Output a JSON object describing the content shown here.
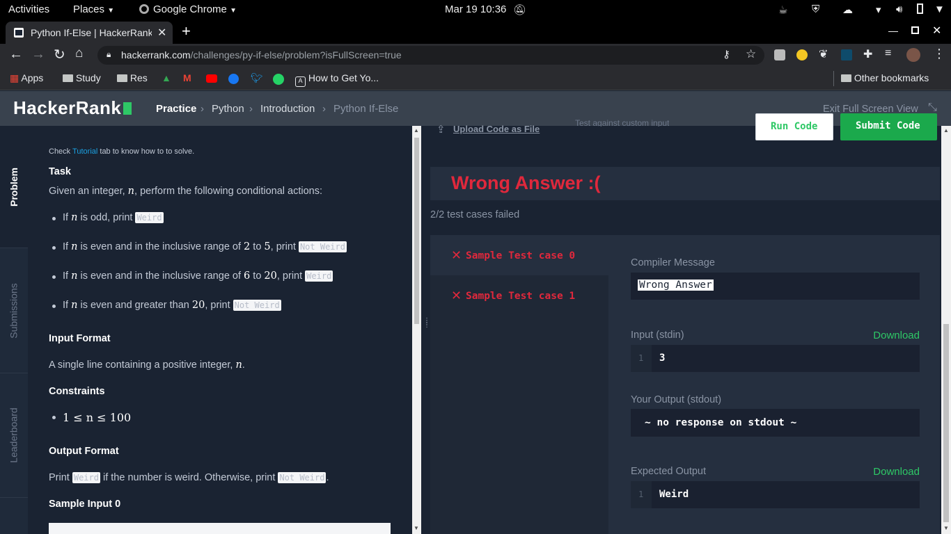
{
  "system": {
    "activities": "Activities",
    "places": "Places",
    "app": "Google Chrome",
    "clock": "Mar 19  10:36"
  },
  "browser": {
    "tab_title": "Python If-Else | HackerRank",
    "url_domain": "hackerrank.com",
    "url_path": "/challenges/py-if-else/problem?isFullScreen=true",
    "bookmarks": [
      "Apps",
      "Study",
      "Res",
      "How to Get Yo..."
    ],
    "other_bookmarks": "Other bookmarks"
  },
  "header": {
    "logo": "HackerRank",
    "breadcrumb": [
      "Practice",
      "Python",
      "Introduction",
      "Python If-Else"
    ],
    "exit_fullscreen": "Exit Full Screen View"
  },
  "side_tabs": [
    "Problem",
    "Submissions",
    "Leaderboard"
  ],
  "problem": {
    "hint_pre": "Check ",
    "hint_link": "Tutorial",
    "hint_post": " tab to know how to to solve.",
    "task_heading": "Task",
    "task_text_pre": "Given an integer, ",
    "task_var": "n",
    "task_text_post": ", perform the following conditional actions:",
    "bullets": [
      {
        "pre": "If ",
        "var": "n",
        "mid": " is odd, print ",
        "out": "Weird"
      },
      {
        "pre": "If ",
        "var": "n",
        "mid": " is even and in the inclusive range of ",
        "a": "2",
        "to": " to ",
        "b": "5",
        "mid2": ", print ",
        "out": "Not Weird"
      },
      {
        "pre": "If ",
        "var": "n",
        "mid": " is even and in the inclusive range of ",
        "a": "6",
        "to": " to ",
        "b": "20",
        "mid2": ", print ",
        "out": "Weird"
      },
      {
        "pre": "If ",
        "var": "n",
        "mid": " is even and greater than ",
        "a": "20",
        "mid2": ", print ",
        "out": "Not Weird"
      }
    ],
    "input_heading": "Input Format",
    "input_text": "A single line containing a positive integer, ",
    "input_var": "n",
    "input_end": ".",
    "constraints_heading": "Constraints",
    "constraint": "1 ≤ n ≤ 100",
    "output_heading": "Output Format",
    "output_pre": "Print ",
    "output_code1": "Weird",
    "output_mid": " if the number is weird. Otherwise, print ",
    "output_code2": "Not Weird",
    "output_end": ".",
    "sample_heading": "Sample Input 0"
  },
  "editor": {
    "upload": "Upload Code as File",
    "custom_input": "Test against custom input",
    "run": "Run Code",
    "submit": "Submit Code"
  },
  "result": {
    "title": "Wrong Answer :(",
    "summary": "2/2 test cases failed",
    "cases": [
      "Sample Test case 0",
      "Sample Test case 1"
    ],
    "compiler_label": "Compiler Message",
    "compiler_message": "Wrong Answer",
    "input_label": "Input (stdin)",
    "download": "Download",
    "input_line_no": "1",
    "input_value": "3",
    "output_label": "Your Output (stdout)",
    "output_value": "~ no response on stdout ~",
    "expected_label": "Expected Output",
    "expected_line_no": "1",
    "expected_value": "Weird"
  },
  "colors": {
    "accent_green": "#2ec866",
    "error_red": "#e0283c",
    "hr_header": "#39424e"
  }
}
